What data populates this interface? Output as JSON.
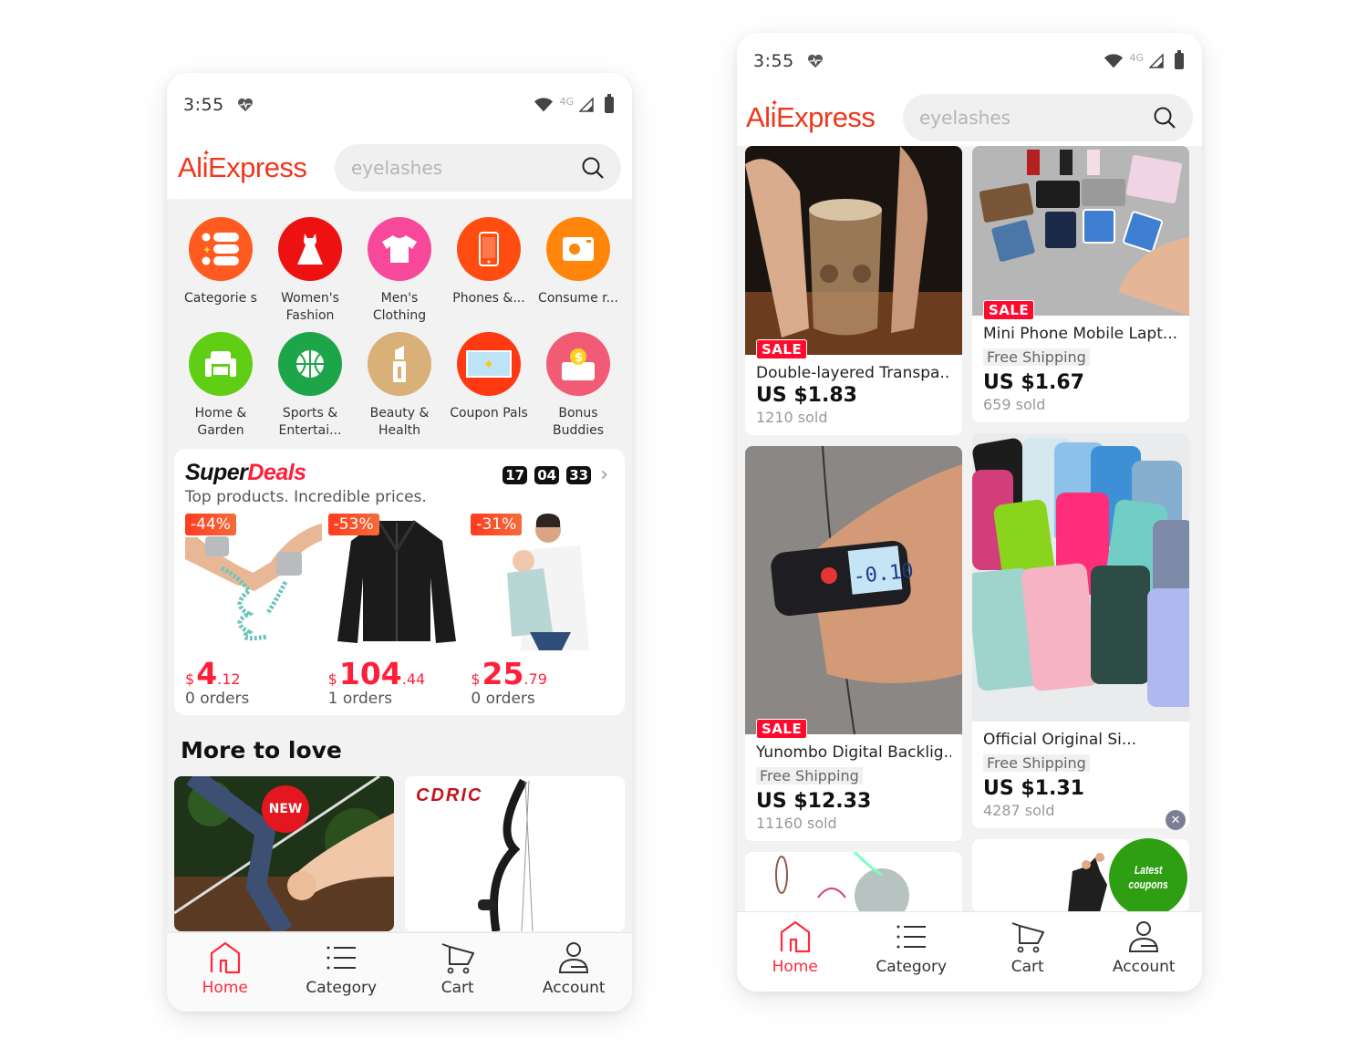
{
  "status_bar": {
    "time": "3:55",
    "network": "4G"
  },
  "header": {
    "logo": "AliExpress",
    "search_placeholder": "eyelashes"
  },
  "left_screen": {
    "categories": [
      {
        "label": "Categorie s",
        "icon": "categories-icon",
        "color": "#ff5a1f"
      },
      {
        "label": "Women's Fashion",
        "icon": "dress-icon",
        "color": "#ee1111"
      },
      {
        "label": "Men's Clothing",
        "icon": "tshirt-icon",
        "color": "#f8489b"
      },
      {
        "label": "Phones &...",
        "icon": "phone-icon",
        "color": "#ff4d12"
      },
      {
        "label": "Consume r...",
        "icon": "camera-icon",
        "color": "#ff860a"
      },
      {
        "label": "Home & Garden",
        "icon": "armchair-icon",
        "color": "#5fce14"
      },
      {
        "label": "Sports & Entertai...",
        "icon": "basketball-icon",
        "color": "#1da54a"
      },
      {
        "label": "Beauty & Health",
        "icon": "lipstick-icon",
        "color": "#d9b077"
      },
      {
        "label": "Coupon Pals",
        "icon": "coupon-icon",
        "color": "#ff3a12"
      },
      {
        "label": "Bonus Buddies",
        "icon": "piggy-bank-icon",
        "color": "#f25b75"
      }
    ],
    "superdeals": {
      "title_part1": "Super",
      "title_part2": "Deals",
      "subtitle": "Top products. Incredible prices.",
      "timer": [
        "17",
        "04",
        "33"
      ],
      "items": [
        {
          "discount": "-44%",
          "currency": "$",
          "price_int": "4",
          "price_dec": ".12",
          "orders": "0 orders",
          "image": "child-safety-wrist-leash"
        },
        {
          "discount": "-53%",
          "currency": "$",
          "price_int": "104",
          "price_dec": ".44",
          "orders": "1 orders",
          "image": "leather-jacket"
        },
        {
          "discount": "-31%",
          "currency": "$",
          "price_int": "25",
          "price_dec": ".79",
          "orders": "0 orders",
          "image": "baby-carrier"
        }
      ]
    },
    "more_to_love": {
      "title": "More to love",
      "cards": [
        {
          "image": "compound-bow-in-hand",
          "badge": "NEW"
        },
        {
          "image": "compound-bow",
          "brand": "CDRIC"
        }
      ]
    }
  },
  "right_screen": {
    "products": [
      {
        "title": "Double-layered Transpa...",
        "price": "US $1.83",
        "sold": "1210 sold",
        "sale": "SALE",
        "free_shipping": null,
        "image": "skull-coffee-glass"
      },
      {
        "title": "Mini Phone Mobile Lapt...",
        "price": "US $1.67",
        "sold": "659 sold",
        "sale": "SALE",
        "free_shipping": "Free Shipping",
        "image": "miniature-devices"
      },
      {
        "title": "Yunombo Digital Backlig...",
        "price": "US $12.33",
        "sold": "11160 sold",
        "sale": "SALE",
        "free_shipping": "Free Shipping",
        "image": "thickness-gauge",
        "gauge_reading": "-0.10"
      },
      {
        "title": "Official Original Si...",
        "price": "US $1.31",
        "sold": "4287 sold",
        "sale": null,
        "free_shipping": "Free Shipping",
        "image": "silicone-phone-cases"
      }
    ],
    "coupon_float": {
      "line1": "Latest",
      "line2": "coupons"
    }
  },
  "bottom_nav": [
    {
      "label": "Home",
      "icon": "home-icon",
      "active": true
    },
    {
      "label": "Category",
      "icon": "list-icon",
      "active": false
    },
    {
      "label": "Cart",
      "icon": "cart-icon",
      "active": false
    },
    {
      "label": "Account",
      "icon": "account-icon",
      "active": false
    }
  ],
  "colors": {
    "brand": "#f0361b",
    "price_red": "#ff1f3a",
    "active_nav": "#ff2a3a",
    "sale_badge": "#ff0a2e",
    "coupon_green": "#2e9e13"
  }
}
